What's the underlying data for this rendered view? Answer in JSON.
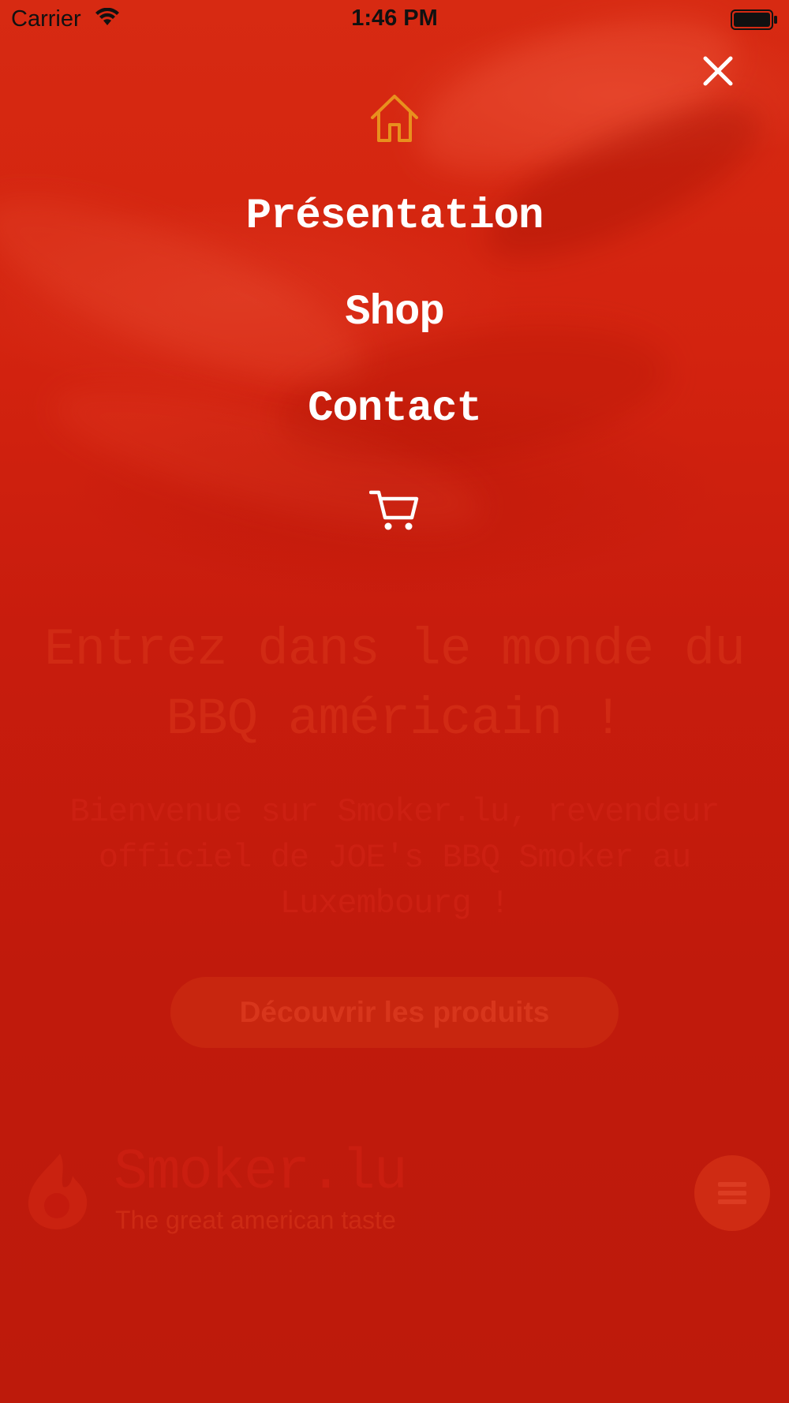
{
  "status_bar": {
    "carrier": "Carrier",
    "time": "1:46 PM"
  },
  "menu": {
    "close_icon": "close-icon",
    "home_icon": "home-icon",
    "items": [
      {
        "label": "Présentation"
      },
      {
        "label": "Shop"
      },
      {
        "label": "Contact"
      }
    ],
    "cart_icon": "cart-icon",
    "icon_color_home": "#e8901e",
    "icon_color": "#ffffff"
  },
  "hero": {
    "title": "Entrez dans le monde du BBQ américain !",
    "subtitle": "Bienvenue sur Smoker.lu, revendeur officiel de JOE's BBQ Smoker au Luxembourg !",
    "cta_label": "Découvrir les produits"
  },
  "footer": {
    "brand_name": "Smoker.lu",
    "tagline": "The great american taste",
    "logo_icon": "flame-icon",
    "menu_icon": "hamburger-icon"
  },
  "colors": {
    "background": "#c11b0c",
    "overlay_text": "#ffffff"
  }
}
